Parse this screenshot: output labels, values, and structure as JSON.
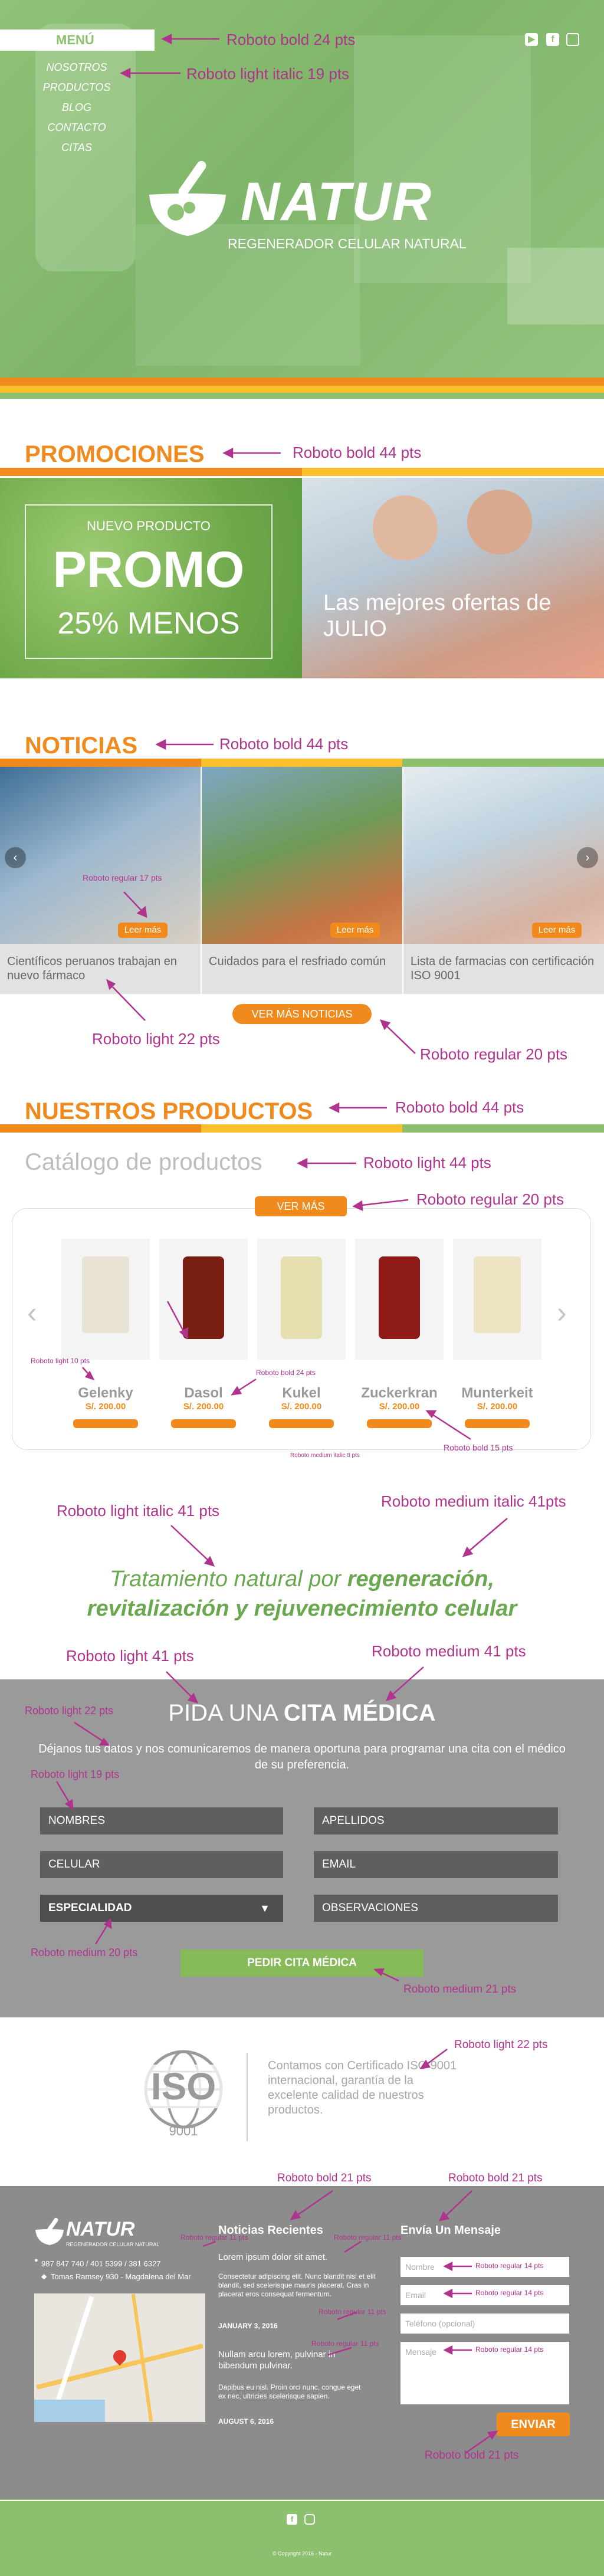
{
  "annotations": {
    "menu": "Roboto bold 24 pts",
    "nav": "Roboto light italic 19 pts",
    "promo": "Roboto bold 44 pts",
    "news": "Roboto bold 44 pts",
    "leer": "Roboto regular 17 pts",
    "news_caption": "Roboto light 22 pts",
    "ver_mas": "Roboto regular 20 pts",
    "products": "Roboto bold 44 pts",
    "catalog": "Roboto light 44 pts",
    "ver_mas2": "Roboto regular 20 pts",
    "prod_small": "Roboto light 10 pts",
    "prod_name": "Roboto bold 24 pts",
    "prod_btn": "Roboto medium italic 8 pts",
    "prod_price": "Roboto bold 15 pts",
    "tagline_left": "Roboto light italic 41 pts",
    "tagline_right": "Roboto medium italic 41pts",
    "cita_left": "Roboto light 41 pts",
    "cita_right": "Roboto medium 41 pts",
    "cita_intro": "Roboto light 22 pts",
    "field": "Roboto light 19 pts",
    "especialidad": "Roboto medium 20 pts",
    "pedir": "Roboto medium 21 pts",
    "iso": "Roboto light 22 pts",
    "footer_col1": "Roboto bold 21 pts",
    "footer_col2": "Roboto bold 21 pts",
    "footer_small1": "Roboto regular 11 pts",
    "footer_small2": "Roboto regular 11 pts",
    "footer_small3": "Roboto regular 11 pts",
    "footer_small4": "Roboto regular 11 pts",
    "footer_in1": "Roboto regular 14 pts",
    "footer_in2": "Roboto regular 14 pts",
    "footer_in3": "Roboto regular 14 pts",
    "enviar": "Roboto bold 21 pts"
  },
  "header": {
    "menu_label": "MENÚ",
    "nav": [
      "NOSOTROS",
      "PRODUCTOS",
      "BLOG",
      "CONTACTO",
      "CITAS"
    ],
    "social": [
      "youtube-icon",
      "facebook-icon",
      "instagram-icon"
    ],
    "brand": "NATUR",
    "tagline": "REGENERADOR CELULAR NATURAL"
  },
  "promos": {
    "title": "PROMOCIONES",
    "box_small": "NUEVO PRODUCTO",
    "box_big": "PROMO",
    "box_sub": "25% MENOS",
    "right_text": "Las mejores ofertas de JULIO"
  },
  "news": {
    "title": "NOTICIAS",
    "leer": "Leer más",
    "items": [
      "Científicos peruanos trabajan en nuevo fármaco",
      "Cuidados para el resfriado común",
      "Lista de farmacias con certificación ISO 9001"
    ],
    "ver_mas": "VER MÁS NOTICIAS"
  },
  "products": {
    "title": "NUESTROS PRODUCTOS",
    "catalog_title": "Catálogo de productos",
    "ver_mas": "VER MÁS",
    "items": [
      {
        "name": "Gelenky",
        "price": "S/. 200.00"
      },
      {
        "name": "Dasol",
        "price": "S/. 200.00"
      },
      {
        "name": "Kukel",
        "price": "S/. 200.00"
      },
      {
        "name": "Zuckerkran",
        "price": "S/. 200.00"
      },
      {
        "name": "Munterkeit",
        "price": "S/. 200.00"
      }
    ]
  },
  "tagline": {
    "light1": "Tratamiento natural por ",
    "bold1": "regeneración,",
    "bold2": "revitalización y rejuvenecimiento celular"
  },
  "cita": {
    "title_light": "PIDA UNA ",
    "title_bold": "CITA MÉDICA",
    "intro": "Déjanos tus datos y nos comunicaremos de manera oportuna para programar una cita con el médico de su preferencia.",
    "fields": [
      "NOMBRES",
      "APELLIDOS",
      "CELULAR",
      "EMAIL",
      "ESPECIALIDAD",
      "OBSERVACIONES"
    ],
    "submit": "PEDIR CITA MÉDICA"
  },
  "iso": {
    "label": "ISO",
    "number": "9001",
    "text": "Contamos con Certificado ISO 9001 internacional, garantía de la excelente calidad de nuestros productos."
  },
  "footer": {
    "brand": "NATUR",
    "tagline": "REGENERADOR CELULAR NATURAL",
    "phone": "987 847 740 / 401 5399 / 381 6327",
    "address": "Tomas Ramsey 930 - Magdalena del Mar",
    "news_title": "Noticias Recientes",
    "news1_title": "Lorem ipsum dolor sit amet.",
    "news1_body": "Consectetur adipiscing elit. Nunc blandit nisi et elit blandit, sed scelerisque mauris placerat. Cras in placerat eros consequat fermentum.",
    "news1_date": "JANUARY 3, 2016",
    "news2_title": "Nullam arcu lorem, pulvinar in bibendum pulvinar.",
    "news2_body": "Dapibus eu nisl. Proin orci nunc, congue eget ex nec, ultricies scelerisque sapien.",
    "news2_date": "AUGUST 6, 2016",
    "msg_title": "Envía Un Mensaje",
    "inputs": [
      "Nombre",
      "Email",
      "Teléfono (opcional)",
      "Mensaje"
    ],
    "send": "ENVIAR",
    "copyright": "© Copyright 2016 - Natur"
  },
  "colors": {
    "green": "#8cc06e",
    "orange": "#f08a1c",
    "yellow": "#fbc02d",
    "gray": "#9a9a9a",
    "magenta": "#b0338e"
  }
}
